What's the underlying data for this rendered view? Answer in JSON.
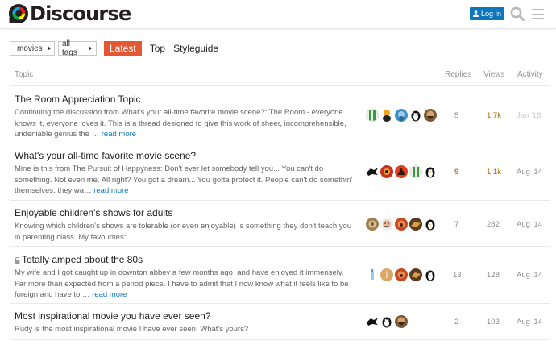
{
  "header": {
    "brand": "Discourse",
    "login_label": "Log In"
  },
  "nav": {
    "category": "movies",
    "tags": "all tags",
    "links": [
      "Latest",
      "Top",
      "Styleguide"
    ]
  },
  "columns": {
    "topic": "Topic",
    "replies": "Replies",
    "views": "Views",
    "activity": "Activity"
  },
  "topics": [
    {
      "title": "The Room Appreciation Topic",
      "excerpt": "Continuing the discussion from What's your all-time favorite movie scene?: The Room - everyone knows it, everyone loves it. This is a thread designed to give this work of sheer, incomprehensible, undeniable genius the …",
      "read_more": "read more",
      "posters": [
        "green-stripe-avatar",
        "orange-figure-avatar",
        "blue-round-avatar",
        "penguin-avatar",
        "bearded-face-avatar"
      ],
      "replies": "5",
      "views": "1.7k",
      "activity": "Jan '18"
    },
    {
      "title": "What's your all-time favorite movie scene?",
      "excerpt": "Mine is this from The Pursuit of Happyness: Don't ever let somebody tell you... You can't do something. Not even me. All right? You got a dream... You gotta protect it. People can't do somethin' themselves, they wa…",
      "read_more": "read more",
      "posters": [
        "black-bird-avatar",
        "red-circle-avatar",
        "orange-red-avatar",
        "green-stripe-avatar",
        "penguin-avatar"
      ],
      "replies": "9",
      "views": "1.1k",
      "activity": "Aug '14"
    },
    {
      "title": "Enjoyable children's shows for adults",
      "excerpt": "Knowing which children's shows are tolerable (or even enjoyable) is something they don't teach you in parenting class. My favourites:",
      "read_more": "",
      "posters": [
        "brown-round-avatar",
        "smiling-face-avatar",
        "red-face-avatar",
        "dark-bird-avatar",
        "penguin-avatar"
      ],
      "replies": "7",
      "views": "282",
      "activity": "Aug '14"
    },
    {
      "title": "Totally amped about the 80s",
      "excerpt": "My wife and I got caught up in downton abbey a few months ago, and have enjoyed it immensely. Far more than expected from a period piece. I have to admit that I now know what it feels like to be foreign and have to …",
      "read_more": "read more",
      "posters": [
        "bottle-avatar",
        "letter-j-avatar",
        "red-face-avatar",
        "dark-bird-avatar",
        "penguin-avatar"
      ],
      "avatar_letter": "j",
      "replies": "13",
      "views": "128",
      "activity": "Aug '14"
    },
    {
      "title": "Most inspirational movie you have ever seen?",
      "excerpt": "Rudy is the most inspirational movie I have ever seen! What's yours?",
      "read_more": "",
      "posters": [
        "black-bird-avatar",
        "penguin-avatar",
        "bearded-face-avatar"
      ],
      "replies": "2",
      "views": "103",
      "activity": "Aug '14"
    }
  ]
}
